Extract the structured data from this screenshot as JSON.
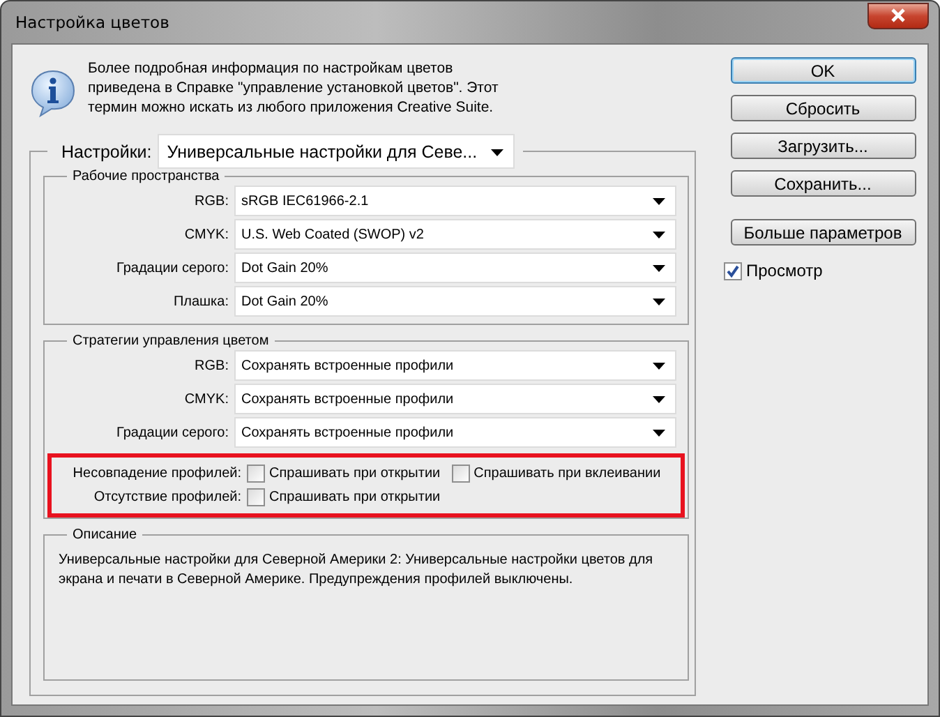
{
  "window": {
    "title": "Настройка цветов"
  },
  "info": {
    "text": "Более подробная информация по настройкам цветов приведена в Справке \"управление установкой цветов\". Этот термин можно искать из любого приложения Creative Suite."
  },
  "settings": {
    "label": "Настройки:",
    "value": "Универсальные настройки для Севе..."
  },
  "working_spaces": {
    "title": "Рабочие пространства",
    "rows": [
      {
        "label": "RGB:",
        "value": "sRGB IEC61966-2.1"
      },
      {
        "label": "CMYK:",
        "value": "U.S. Web Coated (SWOP) v2"
      },
      {
        "label": "Градации серого:",
        "value": "Dot Gain 20%"
      },
      {
        "label": "Плашка:",
        "value": "Dot Gain 20%"
      }
    ]
  },
  "policies": {
    "title": "Стратегии управления цветом",
    "rows": [
      {
        "label": "RGB:",
        "value": "Сохранять встроенные профили"
      },
      {
        "label": "CMYK:",
        "value": "Сохранять встроенные профили"
      },
      {
        "label": "Градации серого:",
        "value": "Сохранять встроенные профили"
      }
    ],
    "highlighted": true,
    "checks": [
      {
        "label": "Несовпадение профилей:",
        "options": [
          {
            "label": "Спрашивать при открытии",
            "checked": false
          },
          {
            "label": "Спрашивать при вклеивании",
            "checked": false
          }
        ]
      },
      {
        "label": "Отсутствие профилей:",
        "options": [
          {
            "label": "Спрашивать при открытии",
            "checked": false
          }
        ]
      }
    ]
  },
  "description": {
    "title": "Описание",
    "text": "Универсальные настройки для Северной Америки 2:  Универсальные настройки цветов для экрана и печати в Северной Америке. Предупреждения профилей выключены."
  },
  "buttons": [
    {
      "label": "OK",
      "default": true
    },
    {
      "label": "Сбросить",
      "default": false
    },
    {
      "label": "Загрузить...",
      "default": false
    },
    {
      "label": "Сохранить...",
      "default": false
    },
    {
      "label": "Больше параметров",
      "default": false
    }
  ],
  "preview": {
    "label": "Просмотр",
    "checked": true
  }
}
